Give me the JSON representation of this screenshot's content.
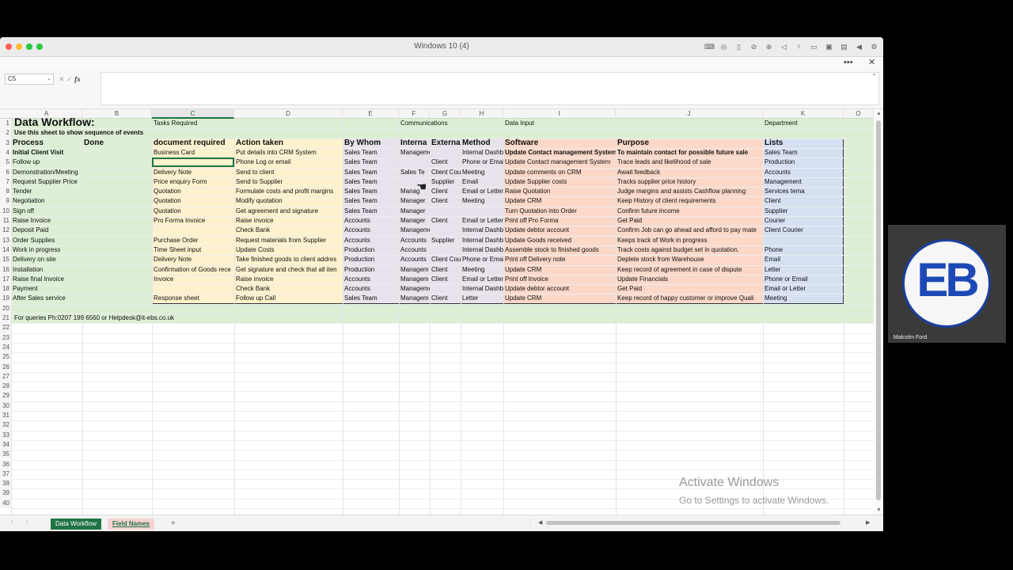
{
  "window": {
    "title": "Windows 10 (4)"
  },
  "titlebar_icons": [
    "keyboard-icon",
    "disc-icon",
    "usb-icon",
    "camera-off-icon",
    "globe-icon",
    "speaker-icon",
    "mic-icon",
    "printer-icon",
    "video-icon",
    "folder-icon",
    "play-icon",
    "gear-icon"
  ],
  "appbar": {
    "more": "•••",
    "close": "✕"
  },
  "formula_bar": {
    "name_box": "C5",
    "fx": "fx",
    "value": ""
  },
  "columns": [
    "A",
    "B",
    "C",
    "D",
    "E",
    "F",
    "G",
    "H",
    "I",
    "J",
    "K",
    "O"
  ],
  "sheet": {
    "title": "Data Workflow:",
    "subtitle": "Use this sheet to show sequence of events",
    "groups": {
      "tasks": "Tasks Required",
      "comms": "Communications",
      "data": "Data Input",
      "dept": "Department"
    },
    "headers": {
      "process": "Process",
      "done": "Done",
      "doc": "document required",
      "action": "Action taken",
      "whom": "By Whom",
      "internal": "Interna",
      "external": "Externa",
      "method": "Method",
      "software": "Software",
      "purpose": "Purpose",
      "lists": "Lists"
    },
    "rows": [
      [
        "Initial Client Visit",
        "Business Card",
        "Put details into CRM System",
        "Sales Team",
        "Management",
        "",
        "Internal Dashb",
        "Update Contact management System",
        "To maintain contact for possible future sale",
        "Sales Team"
      ],
      [
        "Follow up",
        "",
        "Phone Log or email",
        "Sales Team",
        "",
        "Client",
        "Phone or Email",
        "Update Contact management System",
        "Trace leads and likelihood of sale",
        "Production"
      ],
      [
        "Demonstration/Meeting",
        "Delivery Note",
        "Send to client",
        "Sales Team",
        "Sales Te",
        "Client Cou",
        "Meeting",
        "Update comments on CRM",
        "Await feedback",
        "Accounts"
      ],
      [
        "Request Supplier Price",
        "Price enquiry Form",
        "Send to Supplier",
        "Sales Team",
        "",
        "Supplier",
        "Email",
        "Update Supplier costs",
        "Tracks supplier price history",
        "Management"
      ],
      [
        "Tender",
        "Quotation",
        "Formulate costs and profit margins",
        "Sales Team",
        "Manag",
        "Client",
        "Email or Letter",
        "Raise Quotation",
        "Judge margins and assists Cashflow planning",
        "Services tema"
      ],
      [
        "Negotiation",
        "Quotation",
        "Modify quotation",
        "Sales Team",
        "Manager",
        "Client",
        "Meeting",
        "Update CRM",
        "Keep History of client requirements",
        "Client"
      ],
      [
        "Sign off",
        "Quotation",
        "Get agreement and signature",
        "Sales Team",
        "Manager",
        "",
        "",
        "Turn Quotation into Order",
        "Confirm future income",
        "Supplier"
      ],
      [
        "Raise Invoice",
        "Pro Forma Invoice",
        "Raise invoice",
        "Accounts",
        "Manager",
        "Client",
        "Email or Letter",
        "Print off Pro Forma",
        "Get Paid",
        "Courier"
      ],
      [
        "Deposit Paid",
        "",
        "Check Bank",
        "Accounts",
        "Management",
        "",
        "Internal Dashb",
        "Update debtor account",
        "Confirm Job can go ahead and afford to pay mate",
        "Client Courier"
      ],
      [
        "Order Supplies",
        "Purchase Order",
        "Request materials from Supplier",
        "Accounts",
        "Accounts",
        "Supplier",
        "Internal Dashb",
        "Update Goods received",
        "Keeps track of Work in progress",
        ""
      ],
      [
        "Work in progress",
        "Time Sheet input",
        "Update Costs",
        "Production",
        "Accounts",
        "",
        "Internal Dashb",
        "Assemble stock to finished goods",
        "Track costs against budget set in quotation.",
        "Phone"
      ],
      [
        "Delivery on site",
        "Delivery Note",
        "Take finished goods to client addres",
        "Production",
        "Accounts",
        "Client Cou",
        "Phone or Email",
        "Print off Delivery note",
        "Deplete stock from Warehouse",
        "Email"
      ],
      [
        "Installation",
        "Confirmation of Goods rece",
        "Get signature and check that all iten",
        "Production",
        "Managem",
        "Client",
        "Meeting",
        "Update CRM",
        "Keep record of agreement in case of dispute",
        "Letter"
      ],
      [
        "Raise final Invoice",
        "Invoice",
        "Raise invoice",
        "Accounts",
        "Managem",
        "Client",
        "Email or Letter",
        "Print off Invoice",
        "Update Financials",
        "Phone or Email"
      ],
      [
        "Payment",
        "",
        "Check Bank",
        "Accounts",
        "Management",
        "",
        "Internal Dashb",
        "Update debtor account",
        "Get Paid",
        "Email or Letter"
      ],
      [
        "After Sales service",
        "Response sheet",
        "Follow up Call",
        "Sales Team",
        "Managem",
        "Client",
        "Letter",
        "Update CRM",
        "Keep record of happy customer or improve Quali",
        "Meeting"
      ]
    ],
    "footer": "For queries Ph:0207 199 6560 or Helpdesk@it-ebs.co.uk"
  },
  "tabs": {
    "sheet1": "Data Workflow",
    "sheet2": "Field Names",
    "add": "+"
  },
  "activate": {
    "line1": "Activate Windows",
    "line2": "Go to Settings to activate Windows."
  },
  "video": {
    "logo": "EB",
    "name": "Malcolm Ford"
  }
}
